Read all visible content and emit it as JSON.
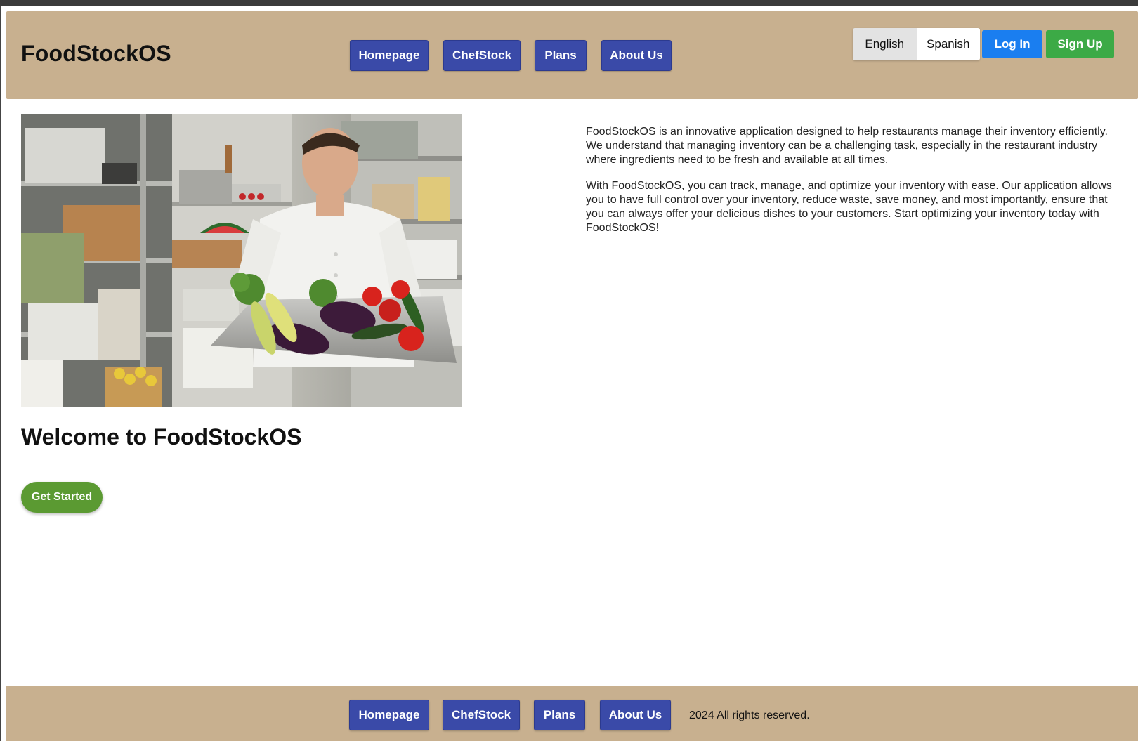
{
  "header": {
    "logo": "FoodStockOS",
    "nav": [
      "Homepage",
      "ChefStock",
      "Plans",
      "About Us"
    ],
    "languages": [
      "English",
      "Spanish"
    ],
    "login_label": "Log In",
    "signup_label": "Sign Up"
  },
  "main": {
    "welcome_title": "Welcome to FoodStockOS",
    "get_started_label": "Get Started",
    "description": [
      "FoodStockOS is an innovative application designed to help restaurants manage their inventory efficiently. We understand that managing inventory can be a challenging task, especially in the restaurant industry where ingredients need to be fresh and available at all times.",
      "With FoodStockOS, you can track, manage, and optimize your inventory with ease. Our application allows you to have full control over your inventory, reduce waste, save money, and most importantly, ensure that you can always offer your delicious dishes to your customers. Start optimizing your inventory today with FoodStockOS!"
    ]
  },
  "footer": {
    "nav": [
      "Homepage",
      "ChefStock",
      "Plans",
      "About Us"
    ],
    "copyright": "2024 All rights reserved."
  },
  "colors": {
    "header_bg": "#c8b08f",
    "nav_button": "#3a4aa8",
    "login": "#1a7ef0",
    "signup": "#3caa46",
    "get_started": "#5b9a32"
  }
}
